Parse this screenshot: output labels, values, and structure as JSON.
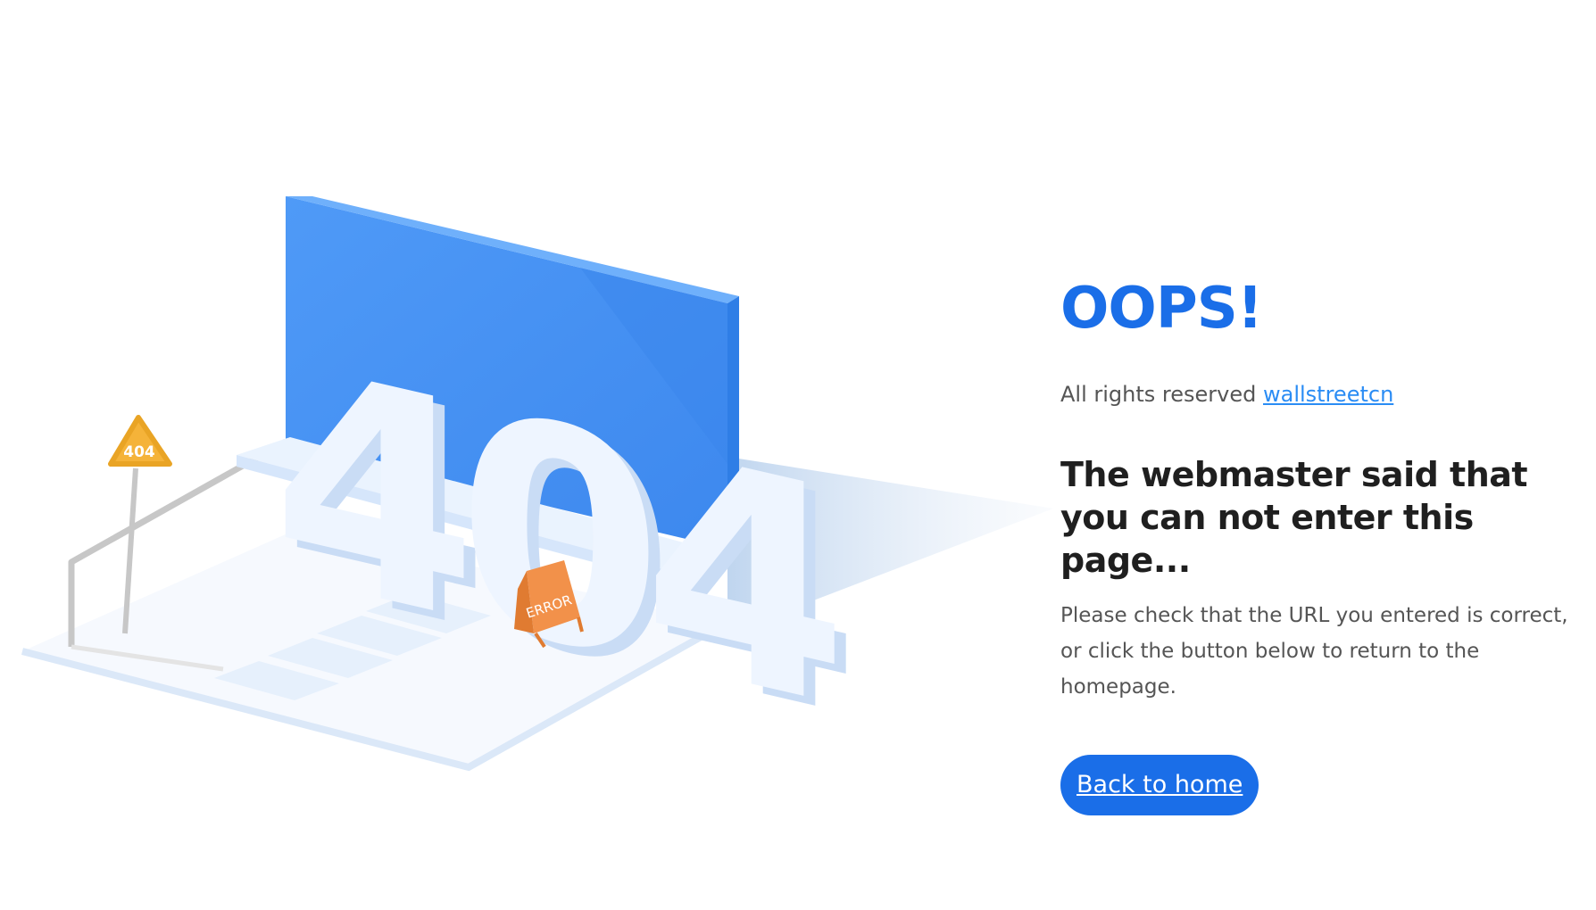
{
  "illustration": {
    "big_digits": "404",
    "sign_text": "404",
    "error_sign_text": "ERROR"
  },
  "content": {
    "title": "OOPS!",
    "rights_prefix": "All rights reserved",
    "rights_link": "wallstreetcn",
    "headline": "The webmaster said that you can not enter this page...",
    "description": "Please check that the URL you entered is correct, or click the button below to return to the homepage.",
    "back_button": "Back to home"
  },
  "colors": {
    "accent": "#1a6ee8",
    "link": "#2a8cf4",
    "panel_blue": "#4a97f5",
    "warning_yellow": "#f5b339",
    "error_orange": "#f2914a"
  }
}
